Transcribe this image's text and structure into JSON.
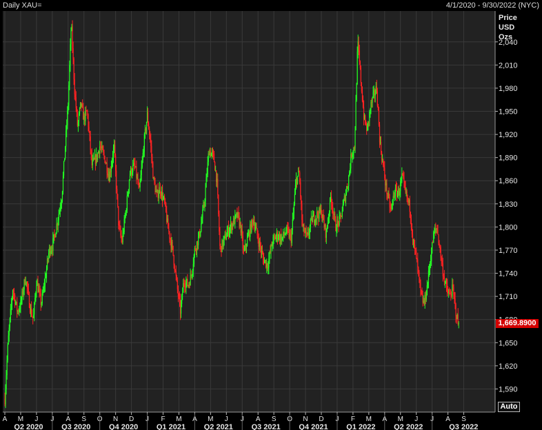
{
  "header": {
    "title": "Daily XAU=",
    "date_range": "4/1/2020 - 9/30/2022 (NYC)"
  },
  "axis": {
    "title_lines": [
      "Price",
      "USD",
      "Ozs"
    ]
  },
  "last_price": "1,669.8900",
  "auto_label": "Auto",
  "colors": {
    "up": "#22ff22",
    "down": "#ff2222",
    "grid": "#3a3a3a",
    "panel": "#222222",
    "badge": "#d40000"
  },
  "chart_data": {
    "type": "candlestick",
    "ylim": [
      1560,
      2080
    ],
    "yticks": [
      1590,
      1620,
      1650,
      1680,
      1710,
      1740,
      1770,
      1800,
      1830,
      1860,
      1890,
      1920,
      1950,
      1980,
      2010,
      2040
    ],
    "ytick_labels": [
      "1,590",
      "1,620",
      "1,650",
      "1,680",
      "1,710",
      "1,740",
      "1,770",
      "1,800",
      "1,830",
      "1,860",
      "1,890",
      "1,920",
      "1,950",
      "1,980",
      "2,010",
      "2,040"
    ],
    "month_labels": [
      "A",
      "M",
      "J",
      "J",
      "A",
      "S",
      "O",
      "N",
      "D",
      "J",
      "F",
      "M",
      "A",
      "M",
      "J",
      "J",
      "A",
      "S",
      "O",
      "N",
      "D",
      "J",
      "F",
      "M",
      "A",
      "M",
      "J",
      "J",
      "A",
      "S"
    ],
    "quarter_labels": [
      "Q2 2020",
      "Q3 2020",
      "Q4 2020",
      "Q1 2021",
      "Q2 2021",
      "Q3 2021",
      "Q4 2021",
      "Q1 2022",
      "Q2 2022",
      "Q3 2022"
    ],
    "quarter_start_month_index": [
      0,
      3,
      6,
      9,
      12,
      15,
      18,
      21,
      24,
      27
    ],
    "price_path": [
      [
        0,
        1577
      ],
      [
        0.2,
        1650
      ],
      [
        0.5,
        1720
      ],
      [
        0.8,
        1690
      ],
      [
        1.0,
        1700
      ],
      [
        1.3,
        1735
      ],
      [
        1.6,
        1695
      ],
      [
        1.8,
        1680
      ],
      [
        2.0,
        1730
      ],
      [
        2.3,
        1700
      ],
      [
        2.6,
        1740
      ],
      [
        2.8,
        1770
      ],
      [
        3.0,
        1775
      ],
      [
        3.3,
        1805
      ],
      [
        3.6,
        1840
      ],
      [
        3.8,
        1900
      ],
      [
        4.0,
        1960
      ],
      [
        4.2,
        2065
      ],
      [
        4.4,
        1980
      ],
      [
        4.6,
        1930
      ],
      [
        4.8,
        1960
      ],
      [
        5.0,
        1940
      ],
      [
        5.2,
        1950
      ],
      [
        5.5,
        1880
      ],
      [
        5.8,
        1890
      ],
      [
        6.0,
        1905
      ],
      [
        6.3,
        1890
      ],
      [
        6.6,
        1865
      ],
      [
        6.9,
        1905
      ],
      [
        7.2,
        1800
      ],
      [
        7.4,
        1780
      ],
      [
        7.7,
        1830
      ],
      [
        7.9,
        1870
      ],
      [
        8.2,
        1880
      ],
      [
        8.5,
        1845
      ],
      [
        8.8,
        1910
      ],
      [
        9.0,
        1945
      ],
      [
        9.2,
        1910
      ],
      [
        9.4,
        1860
      ],
      [
        9.6,
        1840
      ],
      [
        9.8,
        1850
      ],
      [
        10.1,
        1830
      ],
      [
        10.3,
        1800
      ],
      [
        10.6,
        1770
      ],
      [
        10.9,
        1720
      ],
      [
        11.1,
        1690
      ],
      [
        11.3,
        1730
      ],
      [
        11.6,
        1725
      ],
      [
        11.8,
        1740
      ],
      [
        12.0,
        1770
      ],
      [
        12.3,
        1790
      ],
      [
        12.6,
        1830
      ],
      [
        12.9,
        1900
      ],
      [
        13.2,
        1890
      ],
      [
        13.4,
        1860
      ],
      [
        13.6,
        1770
      ],
      [
        13.8,
        1780
      ],
      [
        14.1,
        1795
      ],
      [
        14.4,
        1805
      ],
      [
        14.7,
        1815
      ],
      [
        14.9,
        1800
      ],
      [
        15.1,
        1765
      ],
      [
        15.4,
        1790
      ],
      [
        15.7,
        1810
      ],
      [
        16.0,
        1785
      ],
      [
        16.3,
        1760
      ],
      [
        16.6,
        1750
      ],
      [
        16.9,
        1780
      ],
      [
        17.2,
        1790
      ],
      [
        17.5,
        1785
      ],
      [
        17.8,
        1795
      ],
      [
        18.1,
        1785
      ],
      [
        18.4,
        1860
      ],
      [
        18.6,
        1870
      ],
      [
        18.8,
        1800
      ],
      [
        19.1,
        1785
      ],
      [
        19.4,
        1810
      ],
      [
        19.7,
        1815
      ],
      [
        20.0,
        1820
      ],
      [
        20.3,
        1790
      ],
      [
        20.6,
        1840
      ],
      [
        20.9,
        1800
      ],
      [
        21.2,
        1810
      ],
      [
        21.5,
        1840
      ],
      [
        21.7,
        1860
      ],
      [
        21.9,
        1895
      ],
      [
        22.1,
        1905
      ],
      [
        22.3,
        2040
      ],
      [
        22.5,
        1990
      ],
      [
        22.7,
        1940
      ],
      [
        22.9,
        1925
      ],
      [
        23.1,
        1955
      ],
      [
        23.3,
        1970
      ],
      [
        23.5,
        1980
      ],
      [
        23.7,
        1910
      ],
      [
        23.9,
        1880
      ],
      [
        24.1,
        1850
      ],
      [
        24.4,
        1820
      ],
      [
        24.6,
        1845
      ],
      [
        24.9,
        1845
      ],
      [
        25.1,
        1865
      ],
      [
        25.3,
        1845
      ],
      [
        25.6,
        1825
      ],
      [
        25.8,
        1780
      ],
      [
        26.0,
        1760
      ],
      [
        26.3,
        1710
      ],
      [
        26.5,
        1700
      ],
      [
        26.7,
        1725
      ],
      [
        26.9,
        1760
      ],
      [
        27.1,
        1790
      ],
      [
        27.3,
        1800
      ],
      [
        27.5,
        1770
      ],
      [
        27.7,
        1740
      ],
      [
        27.9,
        1720
      ],
      [
        28.1,
        1710
      ],
      [
        28.3,
        1720
      ],
      [
        28.5,
        1690
      ],
      [
        28.7,
        1669.89
      ]
    ]
  }
}
